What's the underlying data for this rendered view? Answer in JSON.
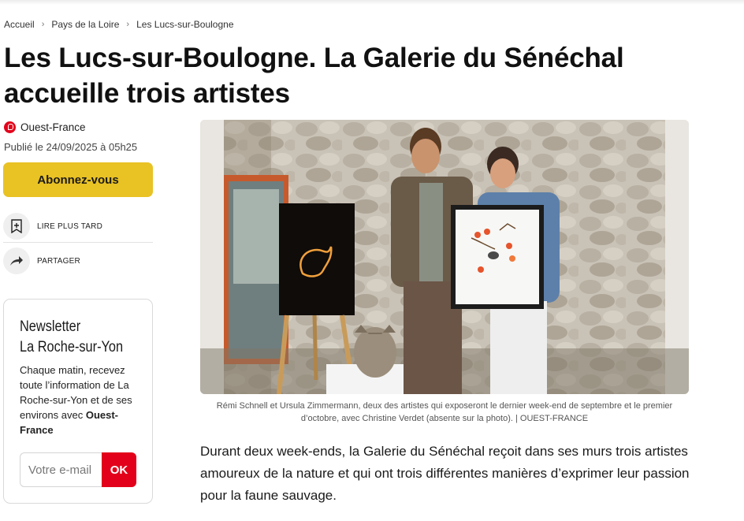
{
  "breadcrumb": [
    "Accueil",
    "Pays de la Loire",
    "Les Lucs-sur-Boulogne"
  ],
  "article": {
    "title": "Les Lucs-sur-Boulogne. La Galerie du Sénéchal accueille trois artistes",
    "source": "Ouest-France",
    "published": "Publié le 24/09/2025 à 05h25",
    "caption": "Rémi Schnell et Ursula Zimmermann, deux des artistes qui exposeront le dernier week-end de septembre et le premier d’octobre, avec Christine Verdet (absente sur la photo). | OUEST-FRANCE",
    "lead": "Durant deux week-ends, la Galerie du Sénéchal reçoit dans ses murs trois artistes amoureux de la nature et qui ont trois différentes manières d’exprimer leur passion pour la faune sauvage."
  },
  "actions": {
    "subscribe": "Abonnez-vous",
    "read_later": "LIRE PLUS TARD",
    "share": "PARTAGER"
  },
  "newsletter": {
    "title_line1": "Newsletter",
    "title_line2": "La Roche-sur-Yon",
    "text": "Chaque matin, recevez toute l’information de La Roche-sur-Yon et de ses environs avec",
    "brand": "Ouest-France",
    "email_placeholder": "Votre e-mail",
    "ok": "OK"
  },
  "colors": {
    "brand_red": "#e2001a",
    "subscribe_yellow": "#e9c224"
  },
  "icons": [
    "bookmark-plus-icon",
    "share-arrow-icon",
    "ouest-france-logo-icon"
  ]
}
